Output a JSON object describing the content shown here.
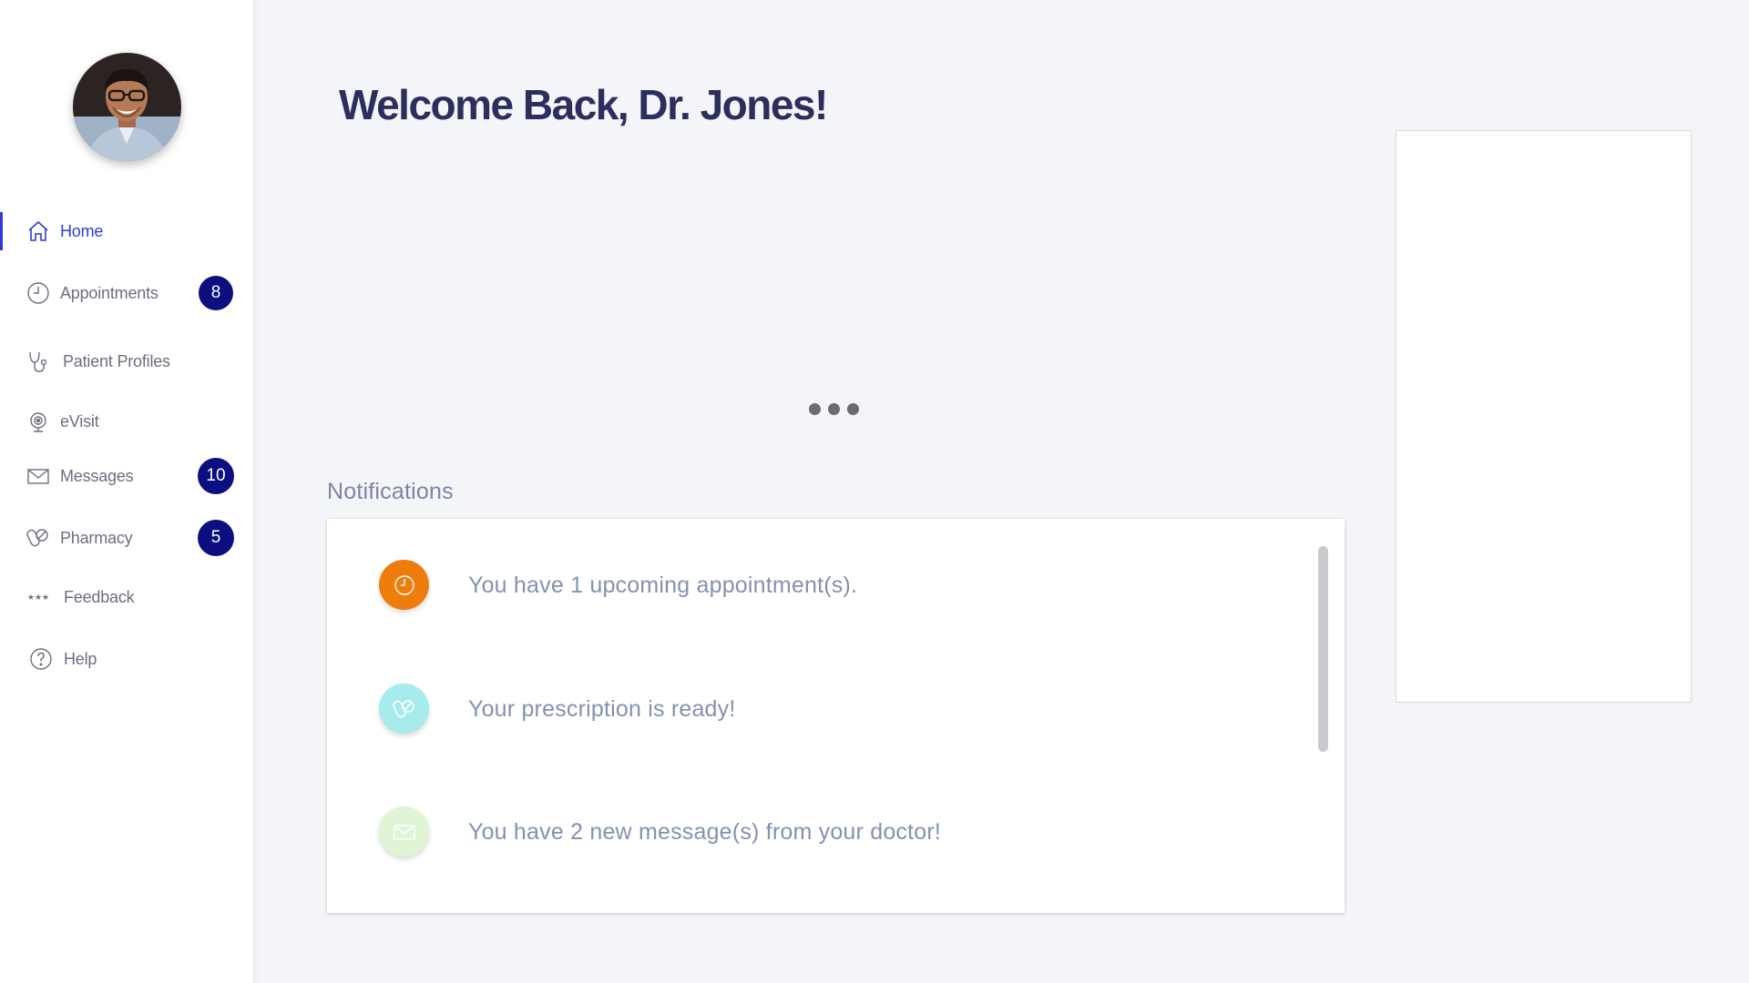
{
  "header": {
    "welcome": "Welcome Back, Dr. Jones!"
  },
  "sidebar": {
    "avatar_alt": "doctor-avatar",
    "items": [
      {
        "label": "Home",
        "icon": "home-icon",
        "active": true
      },
      {
        "label": "Appointments",
        "icon": "clock-icon",
        "badge": "8"
      },
      {
        "label": "Patient Profiles",
        "icon": "stethoscope-icon"
      },
      {
        "label": "eVisit",
        "icon": "webcam-icon"
      },
      {
        "label": "Messages",
        "icon": "envelope-icon",
        "badge": "10"
      },
      {
        "label": "Pharmacy",
        "icon": "pills-icon",
        "badge": "5"
      },
      {
        "label": "Feedback",
        "icon": "stars-icon"
      },
      {
        "label": "Help",
        "icon": "question-icon"
      }
    ]
  },
  "notifications": {
    "title": "Notifications",
    "items": [
      {
        "text": "You have 1 upcoming appointment(s).",
        "icon": "clock-icon",
        "color": "#ef7d0d"
      },
      {
        "text": "Your prescription is ready!",
        "icon": "pills-icon",
        "color": "#a6ecec"
      },
      {
        "text": "You have 2 new message(s) from your doctor!",
        "icon": "envelope-icon",
        "color": "#dff5d6"
      }
    ]
  },
  "colors": {
    "accent": "#2f3bd8",
    "badge": "#0d0f80",
    "heading": "#2c2f5e"
  }
}
